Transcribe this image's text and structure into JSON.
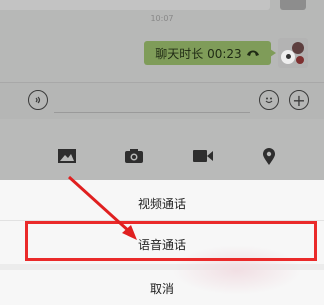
{
  "chat": {
    "timestamp": "10:07",
    "call_message": "聊天时长 00:23",
    "call_icon": "hangup-phone-icon"
  },
  "input_bar": {
    "voice_icon": "voice-icon",
    "emoji_icon": "emoji-icon",
    "plus_icon": "plus-icon",
    "plus_glyph": "+"
  },
  "tools": [
    "photo-icon",
    "camera-icon",
    "video-call-icon",
    "location-icon"
  ],
  "action_sheet": {
    "video_call": "视频通话",
    "voice_call": "语音通话",
    "cancel": "取消"
  },
  "colors": {
    "highlight": "#ea2a2a",
    "bubble": "#7f9c59",
    "arrow": "#e02020"
  }
}
